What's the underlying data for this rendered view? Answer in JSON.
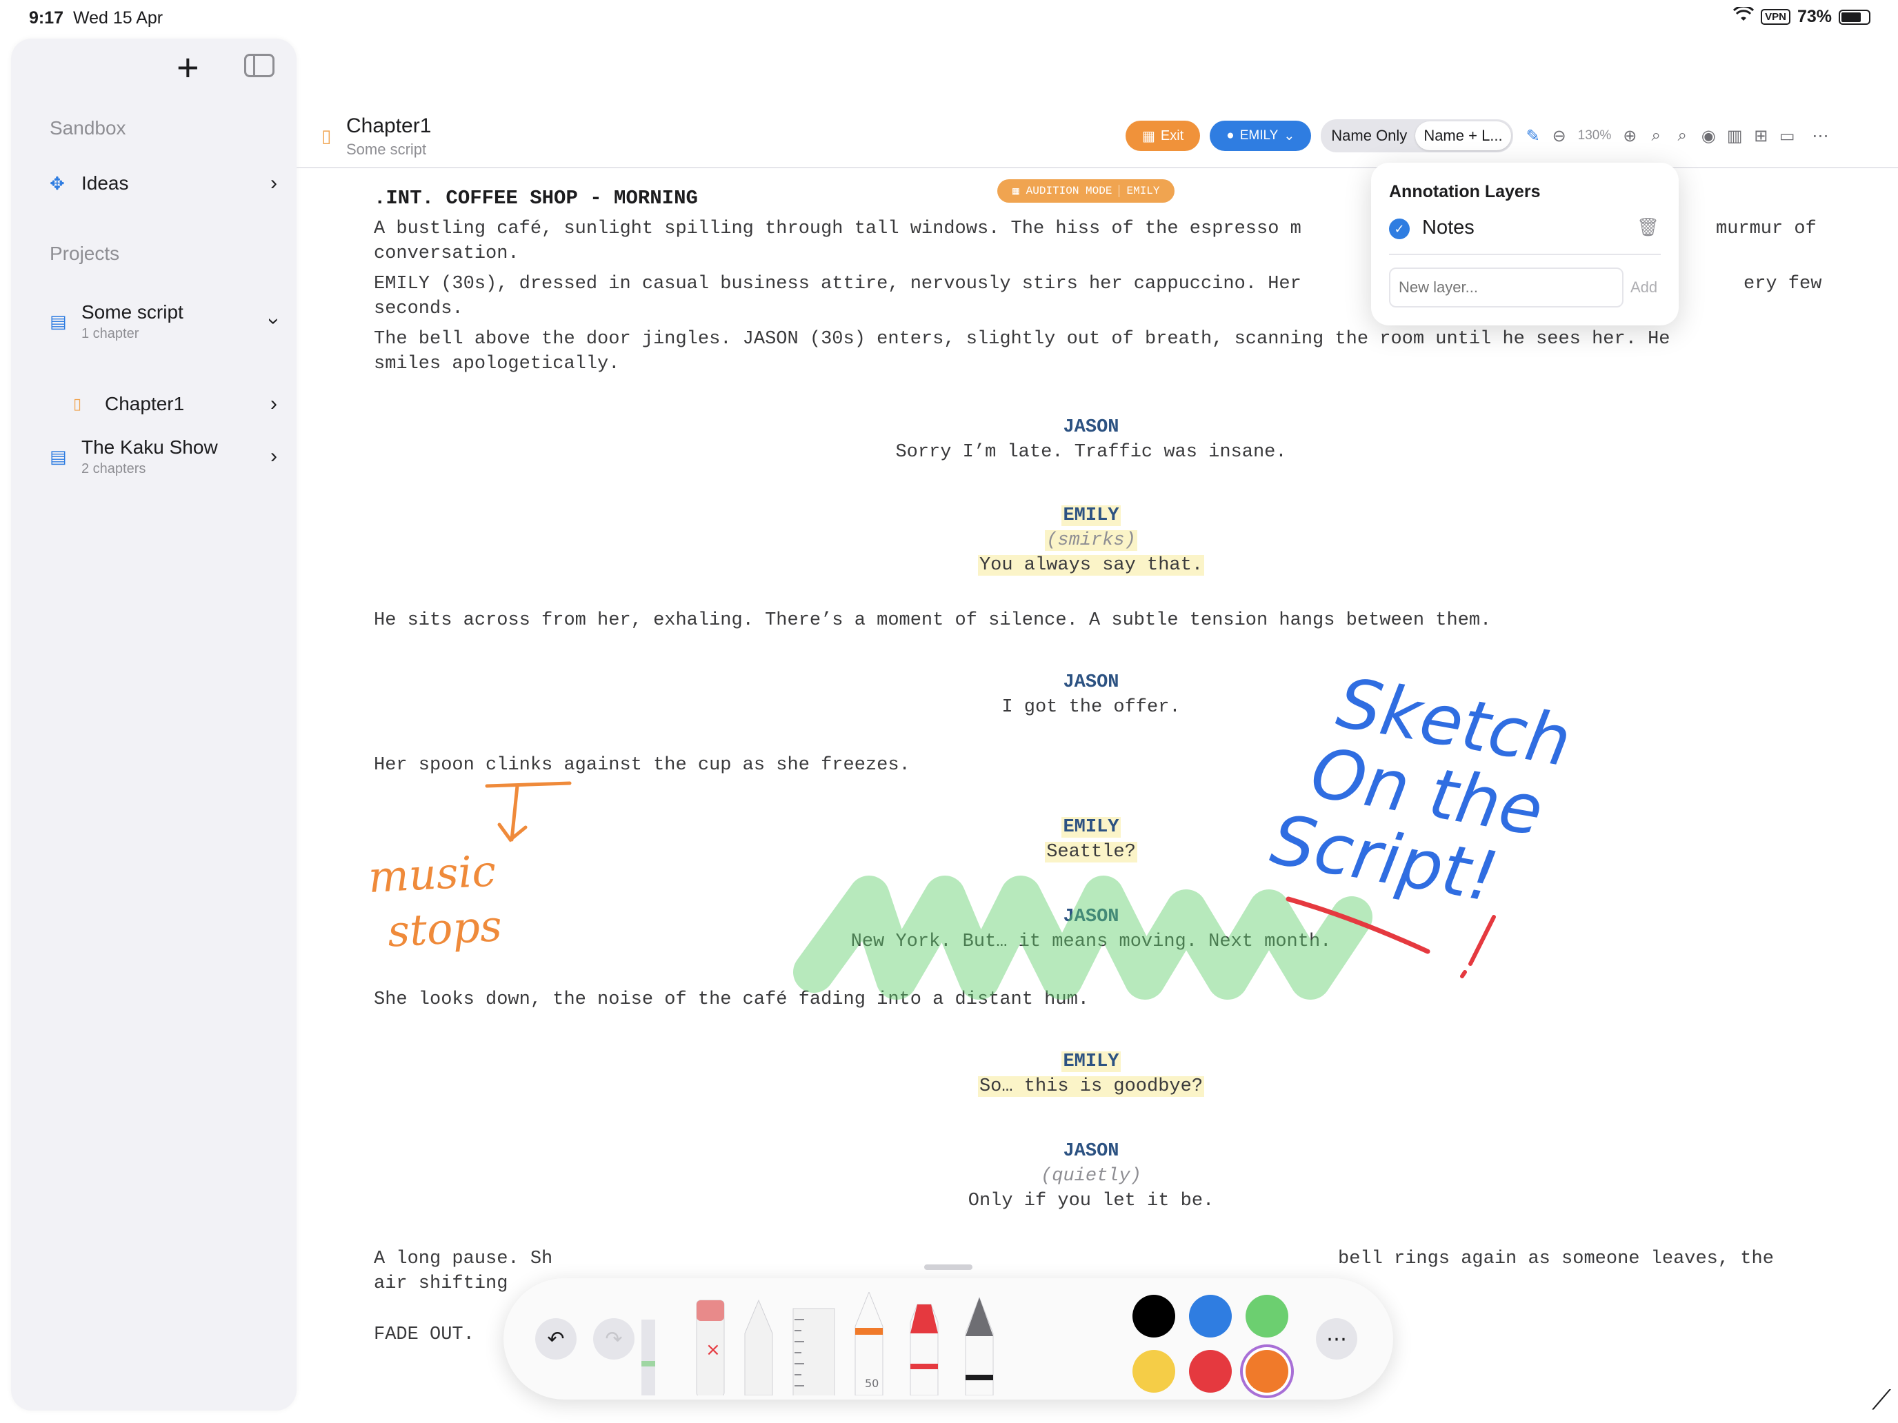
{
  "status": {
    "time": "9:17",
    "date": "Wed 15 Apr",
    "vpn": "VPN",
    "battery": "73%"
  },
  "sidebar": {
    "sandbox_label": "Sandbox",
    "ideas_label": "Ideas",
    "projects_label": "Projects",
    "projects": [
      {
        "title": "Some script",
        "subtitle": "1 chapter",
        "chapters": [
          {
            "title": "Chapter1"
          }
        ]
      },
      {
        "title": "The Kaku Show",
        "subtitle": "2 chapters"
      }
    ]
  },
  "document": {
    "title": "Chapter1",
    "subtitle": "Some script"
  },
  "toolbar": {
    "exit_label": "Exit",
    "character_label": "EMILY",
    "view_modes": [
      "Name Only",
      "Name + L..."
    ],
    "zoom": "130%"
  },
  "audition": {
    "mode": "AUDITION MODE",
    "character": "EMILY"
  },
  "annotation_popover": {
    "title": "Annotation Layers",
    "layers": [
      {
        "name": "Notes",
        "checked": true
      }
    ],
    "new_layer_placeholder": "New layer...",
    "add_label": "Add"
  },
  "script": {
    "scene_heading": ".INT. COFFEE SHOP - MORNING",
    "action1": [
      "A bustling café, sunlight spilling through tall windows. The hiss of the espresso m",
      "conversation."
    ],
    "action1_tail": "murmur of",
    "action2": [
      "EMILY (30s), dressed in casual business attire, nervously stirs her cappuccino. Her",
      "seconds."
    ],
    "action2_tail": "ery few",
    "action3": [
      "The bell above the door jingles. JASON (30s) enters, slightly out of breath, scanning the room until he sees her. He",
      "smiles apologetically."
    ],
    "d1_char": "JASON",
    "d1_line": "Sorry I’m late. Traffic was insane.",
    "d2_char": "EMILY",
    "d2_paren": "(smirks)",
    "d2_line": "You always say that.",
    "action4": "He sits across from her, exhaling. There’s a moment of silence. A subtle tension hangs between them.",
    "d3_char": "JASON",
    "d3_line": "I got the offer.",
    "action5": "Her spoon clinks against the cup as she freezes.",
    "d4_char": "EMILY",
    "d4_line": "Seattle?",
    "d5_char": "JASON",
    "d5_line": "New York. But… it means moving. Next month.",
    "action6": "She looks down, the noise of the café fading into a distant hum.",
    "d6_char": "EMILY",
    "d6_line": "So… this is goodbye?",
    "d7_char": "JASON",
    "d7_paren": "(quietly)",
    "d7_line": "Only if you let it be.",
    "action7_start": "A long pause. Sh",
    "action7_end": "bell rings again as someone leaves, the",
    "action7_line2": "air shifting",
    "transition": "FADE OUT."
  },
  "handwriting": {
    "left_note": [
      "music",
      "stops"
    ],
    "right_note": [
      "Sketch",
      "On the",
      "Script!"
    ]
  },
  "palette": {
    "marker_size": "50",
    "colors": [
      "#000000",
      "#2f7de1",
      "#6ccf70",
      "#f5cd47",
      "#e5393f",
      "#f07a2a"
    ]
  }
}
